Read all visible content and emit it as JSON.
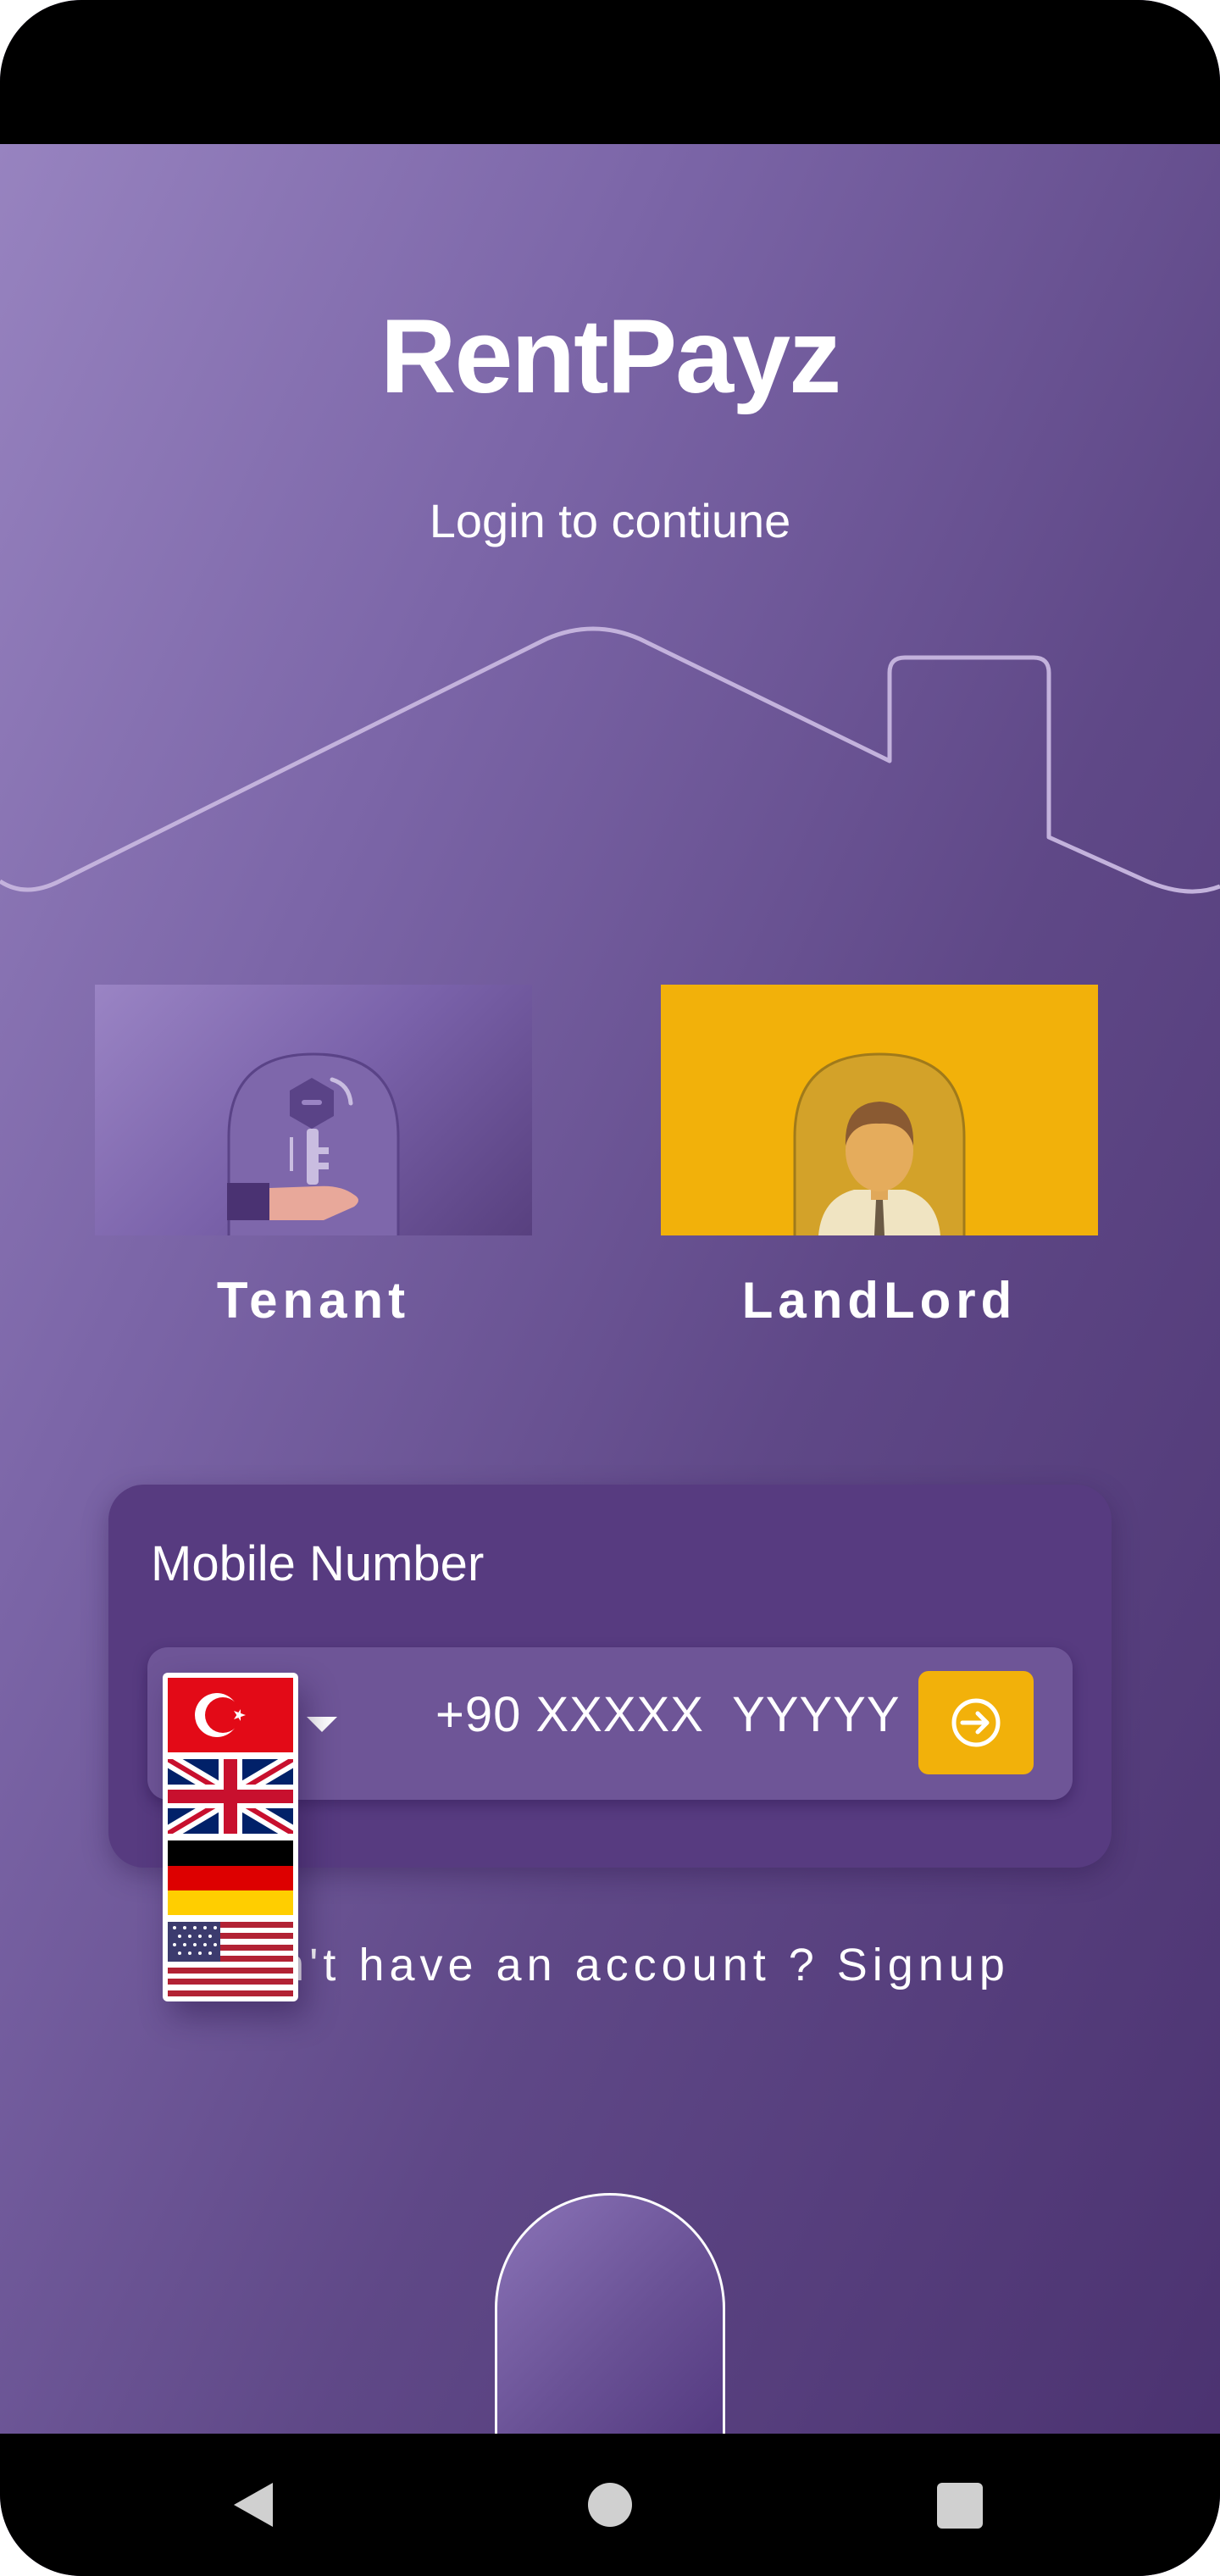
{
  "app": {
    "title": "RentPayz",
    "subtitle": "Login to contiune"
  },
  "roles": {
    "tenant_label": "Tenant",
    "landlord_label": "LandLord",
    "selected": "LandLord",
    "accent_color": "#f2b10a"
  },
  "login": {
    "mobile_label": "Mobile Number",
    "phone_placeholder": "+90 XXXXX  YYYYY",
    "submit_icon": "login-arrow-icon"
  },
  "country_dropdown": {
    "selected": "TR",
    "options": [
      "TR",
      "GB",
      "DE",
      "US"
    ]
  },
  "signup": {
    "text": "Don't have an account ? Signup"
  },
  "system_nav": {
    "icons": [
      "back-icon",
      "home-icon",
      "recents-icon"
    ]
  },
  "colors": {
    "background_start": "#9a86c2",
    "background_end": "#4a316f",
    "card": "#573b80",
    "accent": "#f2b10a"
  }
}
